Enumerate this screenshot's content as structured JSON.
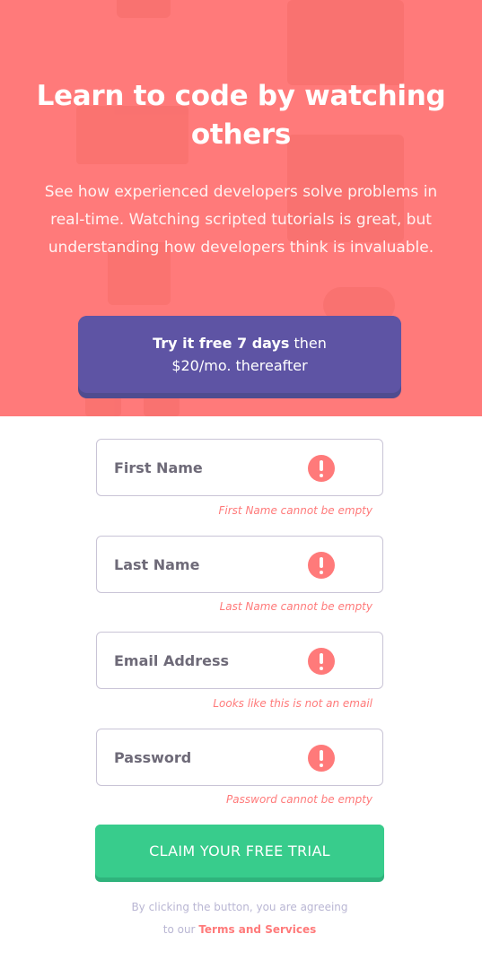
{
  "hero": {
    "title": "Learn to code by watching others",
    "text": "See how experienced developers solve problems in real-time. Watching scripted tutorials is great, but understanding how developers think is invaluable."
  },
  "trial": {
    "bold": "Try it free 7 days",
    "rest_line1": " then",
    "line2": "$20/mo. thereafter"
  },
  "form": {
    "fields": [
      {
        "placeholder": "First Name",
        "error": "First Name cannot be empty",
        "icon": "error-icon"
      },
      {
        "placeholder": "Last Name",
        "error": "Last Name cannot be empty",
        "icon": "error-icon"
      },
      {
        "placeholder": "Email Address",
        "error": "Looks like this is not an email",
        "icon": "error-icon"
      },
      {
        "placeholder": "Password",
        "error": "Password cannot be empty",
        "icon": "error-icon"
      }
    ],
    "submit_label": "CLAIM YOUR FREE TRIAL",
    "terms_prefix_line1": "By clicking the button, you are agreeing",
    "terms_prefix_line2": "to our ",
    "terms_link": "Terms and Services"
  },
  "colors": {
    "hero_bg": "#ff7a7a",
    "trial_box": "#5e54a4",
    "cta": "#38cc8c",
    "error": "#ff7a7a",
    "field_border": "#c9c4d6",
    "terms_text": "#b9b6d3"
  }
}
